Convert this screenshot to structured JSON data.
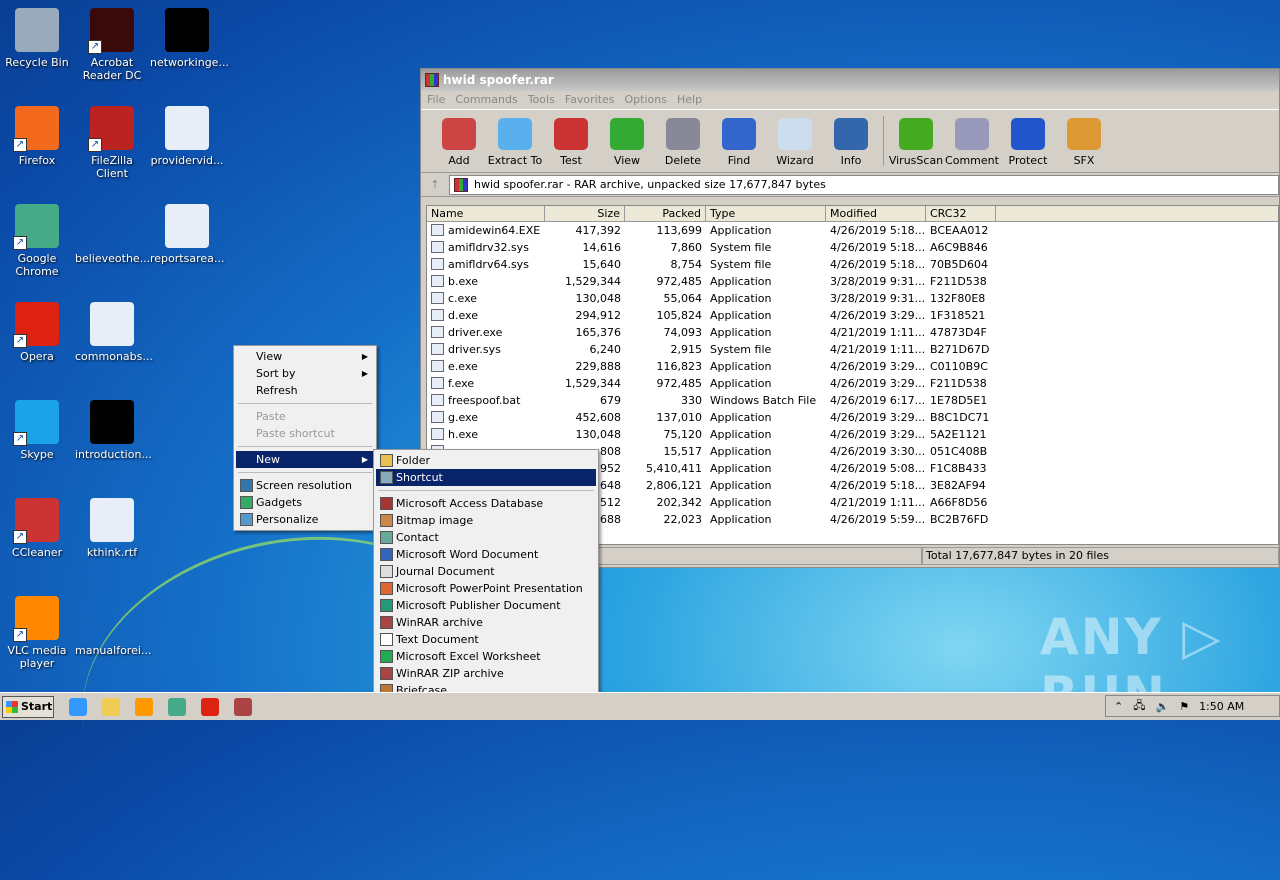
{
  "desktop_icons": [
    {
      "label": "Recycle Bin",
      "color": "#9ab",
      "col": 0,
      "row": 0,
      "shortcut": false
    },
    {
      "label": "Acrobat Reader DC",
      "color": "#3a0a0a",
      "col": 1,
      "row": 0,
      "shortcut": true
    },
    {
      "label": "networkinge...",
      "color": "#000",
      "col": 2,
      "row": 0,
      "shortcut": false
    },
    {
      "label": "Firefox",
      "color": "#f36a1d",
      "col": 0,
      "row": 1,
      "shortcut": true
    },
    {
      "label": "FileZilla Client",
      "color": "#b22",
      "col": 1,
      "row": 1,
      "shortcut": true
    },
    {
      "label": "providervid...",
      "color": "#e8eef8",
      "col": 2,
      "row": 1,
      "shortcut": false
    },
    {
      "label": "Google Chrome",
      "color": "#4a8",
      "col": 0,
      "row": 2,
      "shortcut": true
    },
    {
      "label": "believeothe...",
      "color": "transparent",
      "col": 1,
      "row": 2,
      "shortcut": false
    },
    {
      "label": "reportsarea...",
      "color": "#e8eef8",
      "col": 2,
      "row": 2,
      "shortcut": false
    },
    {
      "label": "Opera",
      "color": "#d21",
      "col": 0,
      "row": 3,
      "shortcut": true
    },
    {
      "label": "commonabs...",
      "color": "#e8eef8",
      "col": 1,
      "row": 3,
      "shortcut": false
    },
    {
      "label": "Skype",
      "color": "#1ba3e8",
      "col": 0,
      "row": 4,
      "shortcut": true
    },
    {
      "label": "introduction...",
      "color": "#000",
      "col": 1,
      "row": 4,
      "shortcut": false
    },
    {
      "label": "CCleaner",
      "color": "#c33",
      "col": 0,
      "row": 5,
      "shortcut": true
    },
    {
      "label": "kthink.rtf",
      "color": "#e8eef8",
      "col": 1,
      "row": 5,
      "shortcut": false
    },
    {
      "label": "VLC media player",
      "color": "#f80",
      "col": 0,
      "row": 6,
      "shortcut": true
    },
    {
      "label": "manualforei...",
      "color": "transparent",
      "col": 1,
      "row": 6,
      "shortcut": false
    }
  ],
  "window": {
    "title": "hwid spoofer.rar",
    "menu": [
      "File",
      "Commands",
      "Tools",
      "Favorites",
      "Options",
      "Help"
    ],
    "toolbar": [
      {
        "label": "Add",
        "color": "#c44"
      },
      {
        "label": "Extract To",
        "color": "#5ab0ec"
      },
      {
        "label": "Test",
        "color": "#c33"
      },
      {
        "label": "View",
        "color": "#3a3"
      },
      {
        "label": "Delete",
        "color": "#889"
      },
      {
        "label": "Find",
        "color": "#36c"
      },
      {
        "label": "Wizard",
        "color": "#cde"
      },
      {
        "label": "Info",
        "color": "#36a"
      },
      {
        "label": "VirusScan",
        "color": "#4a2"
      },
      {
        "label": "Comment",
        "color": "#99b"
      },
      {
        "label": "Protect",
        "color": "#25c"
      },
      {
        "label": "SFX",
        "color": "#d93"
      }
    ],
    "address": "hwid spoofer.rar - RAR archive, unpacked size 17,677,847 bytes",
    "columns": [
      "Name",
      "Size",
      "Packed",
      "Type",
      "Modified",
      "CRC32"
    ],
    "files": [
      [
        "amidewin64.EXE",
        "417,392",
        "113,699",
        "Application",
        "4/26/2019 5:18...",
        "BCEAA012"
      ],
      [
        "amifldrv32.sys",
        "14,616",
        "7,860",
        "System file",
        "4/26/2019 5:18...",
        "A6C9B846"
      ],
      [
        "amifldrv64.sys",
        "15,640",
        "8,754",
        "System file",
        "4/26/2019 5:18...",
        "70B5D604"
      ],
      [
        "b.exe",
        "1,529,344",
        "972,485",
        "Application",
        "3/28/2019 9:31...",
        "F211D538"
      ],
      [
        "c.exe",
        "130,048",
        "55,064",
        "Application",
        "3/28/2019 9:31...",
        "132F80E8"
      ],
      [
        "d.exe",
        "294,912",
        "105,824",
        "Application",
        "4/26/2019 3:29...",
        "1F318521"
      ],
      [
        "driver.exe",
        "165,376",
        "74,093",
        "Application",
        "4/21/2019 1:11...",
        "47873D4F"
      ],
      [
        "driver.sys",
        "6,240",
        "2,915",
        "System file",
        "4/21/2019 1:11...",
        "B271D67D"
      ],
      [
        "e.exe",
        "229,888",
        "116,823",
        "Application",
        "4/26/2019 3:29...",
        "C0110B9C"
      ],
      [
        "f.exe",
        "1,529,344",
        "972,485",
        "Application",
        "4/26/2019 3:29...",
        "F211D538"
      ],
      [
        "freespoof.bat",
        "679",
        "330",
        "Windows Batch File",
        "4/26/2019 6:17...",
        "1E78D5E1"
      ],
      [
        "g.exe",
        "452,608",
        "137,010",
        "Application",
        "4/26/2019 3:29...",
        "B8C1DC71"
      ],
      [
        "h.exe",
        "130,048",
        "75,120",
        "Application",
        "4/26/2019 3:29...",
        "5A2E1121"
      ],
      [
        "",
        "808",
        "15,517",
        "Application",
        "4/26/2019 3:30...",
        "051C408B"
      ],
      [
        "",
        "952",
        "5,410,411",
        "Application",
        "4/26/2019 5:08...",
        "F1C8B433"
      ],
      [
        "",
        "648",
        "2,806,121",
        "Application",
        "4/26/2019 5:18...",
        "3E82AF94"
      ],
      [
        "",
        "512",
        "202,342",
        "Application",
        "4/21/2019 1:11...",
        "A66F8D56"
      ],
      [
        "",
        "688",
        "22,023",
        "Application",
        "4/26/2019 5:59...",
        "BC2B76FD"
      ]
    ],
    "status": "Total 17,677,847 bytes in 20 files"
  },
  "context_menu": [
    {
      "label": "View",
      "sub": true
    },
    {
      "label": "Sort by",
      "sub": true
    },
    {
      "label": "Refresh"
    },
    {
      "sep": true
    },
    {
      "label": "Paste",
      "disabled": true
    },
    {
      "label": "Paste shortcut",
      "disabled": true
    },
    {
      "sep": true
    },
    {
      "label": "New",
      "sub": true,
      "highlight": true
    },
    {
      "sep": true
    },
    {
      "label": "Screen resolution",
      "icon": "#37a"
    },
    {
      "label": "Gadgets",
      "icon": "#3a6"
    },
    {
      "label": "Personalize",
      "icon": "#59c"
    }
  ],
  "new_submenu": [
    {
      "label": "Folder",
      "icon": "#e8c050"
    },
    {
      "label": "Shortcut",
      "icon": "#8ab",
      "highlight": true
    },
    {
      "sep": true
    },
    {
      "label": "Microsoft Access Database",
      "icon": "#a33"
    },
    {
      "label": "Bitmap image",
      "icon": "#c84"
    },
    {
      "label": "Contact",
      "icon": "#6a9"
    },
    {
      "label": "Microsoft Word Document",
      "icon": "#36b"
    },
    {
      "label": "Journal Document",
      "icon": "#ddd"
    },
    {
      "label": "Microsoft PowerPoint Presentation",
      "icon": "#d63"
    },
    {
      "label": "Microsoft Publisher Document",
      "icon": "#297"
    },
    {
      "label": "WinRAR archive",
      "icon": "#a44"
    },
    {
      "label": "Text Document",
      "icon": "#fff"
    },
    {
      "label": "Microsoft Excel Worksheet",
      "icon": "#2a5"
    },
    {
      "label": "WinRAR ZIP archive",
      "icon": "#a44"
    },
    {
      "label": "Briefcase",
      "icon": "#b73"
    }
  ],
  "taskbar": {
    "start": "Start",
    "apps": [
      {
        "name": "internet-explorer",
        "color": "#39f"
      },
      {
        "name": "explorer",
        "color": "#ec5"
      },
      {
        "name": "media-player",
        "color": "#f90"
      },
      {
        "name": "chrome",
        "color": "#4a8"
      },
      {
        "name": "opera",
        "color": "#d21"
      },
      {
        "name": "winrar",
        "color": "#a44"
      }
    ],
    "clock": "1:50 AM"
  },
  "watermark": "ANY ▷ RUN"
}
